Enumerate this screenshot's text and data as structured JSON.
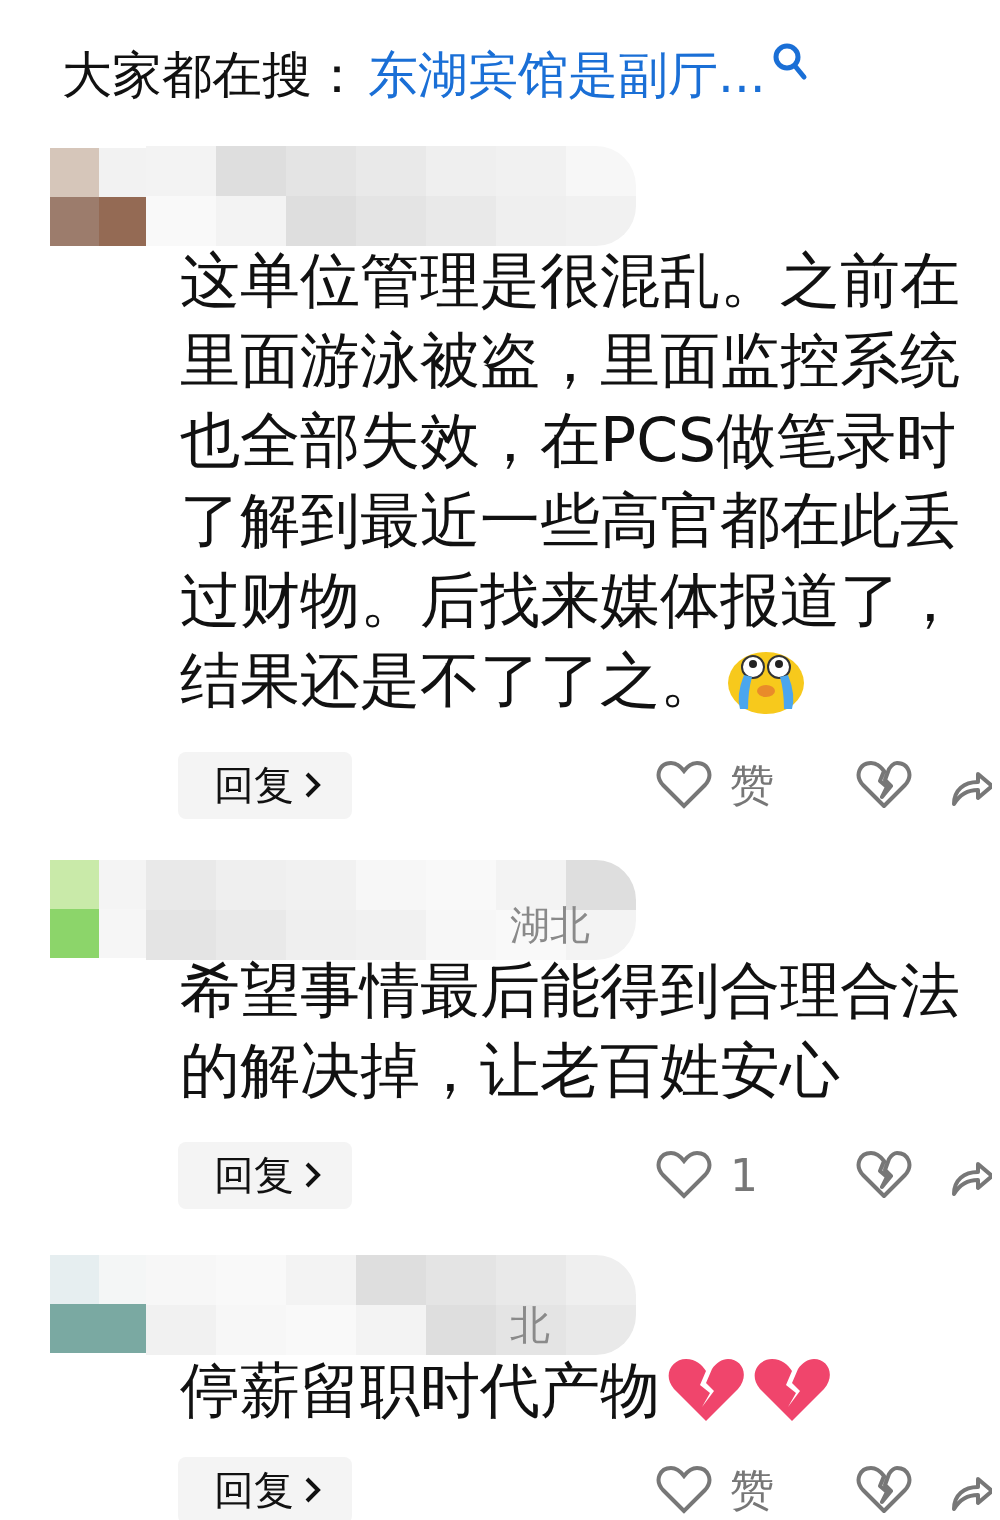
{
  "search_bar": {
    "label": "大家都在搜：",
    "query": "东湖宾馆是副厅..."
  },
  "comments": [
    {
      "lines": [
        "这单位管理是很混乱。之前在",
        "里面游泳被盗，里面监控系统",
        "也全部失效，在PCS做笔录时",
        "了解到最近一些高官都在此丢",
        "过财物。后找来媒体报道了，",
        "结果还是不了了之。"
      ],
      "emojis": [
        {
          "kind": "crying"
        }
      ],
      "reply": "回复",
      "likes": "赞"
    },
    {
      "location": "湖北",
      "lines": [
        "希望事情最后能得到合理合法",
        "的解决掉，让老百姓安心"
      ],
      "reply": "回复",
      "likes": "1"
    },
    {
      "location": "北",
      "lines": [
        "停薪留职时代产物"
      ],
      "emojis": [
        {
          "kind": "broken-heart"
        },
        {
          "kind": "broken-heart"
        }
      ],
      "reply": "回复",
      "likes": "赞"
    }
  ]
}
